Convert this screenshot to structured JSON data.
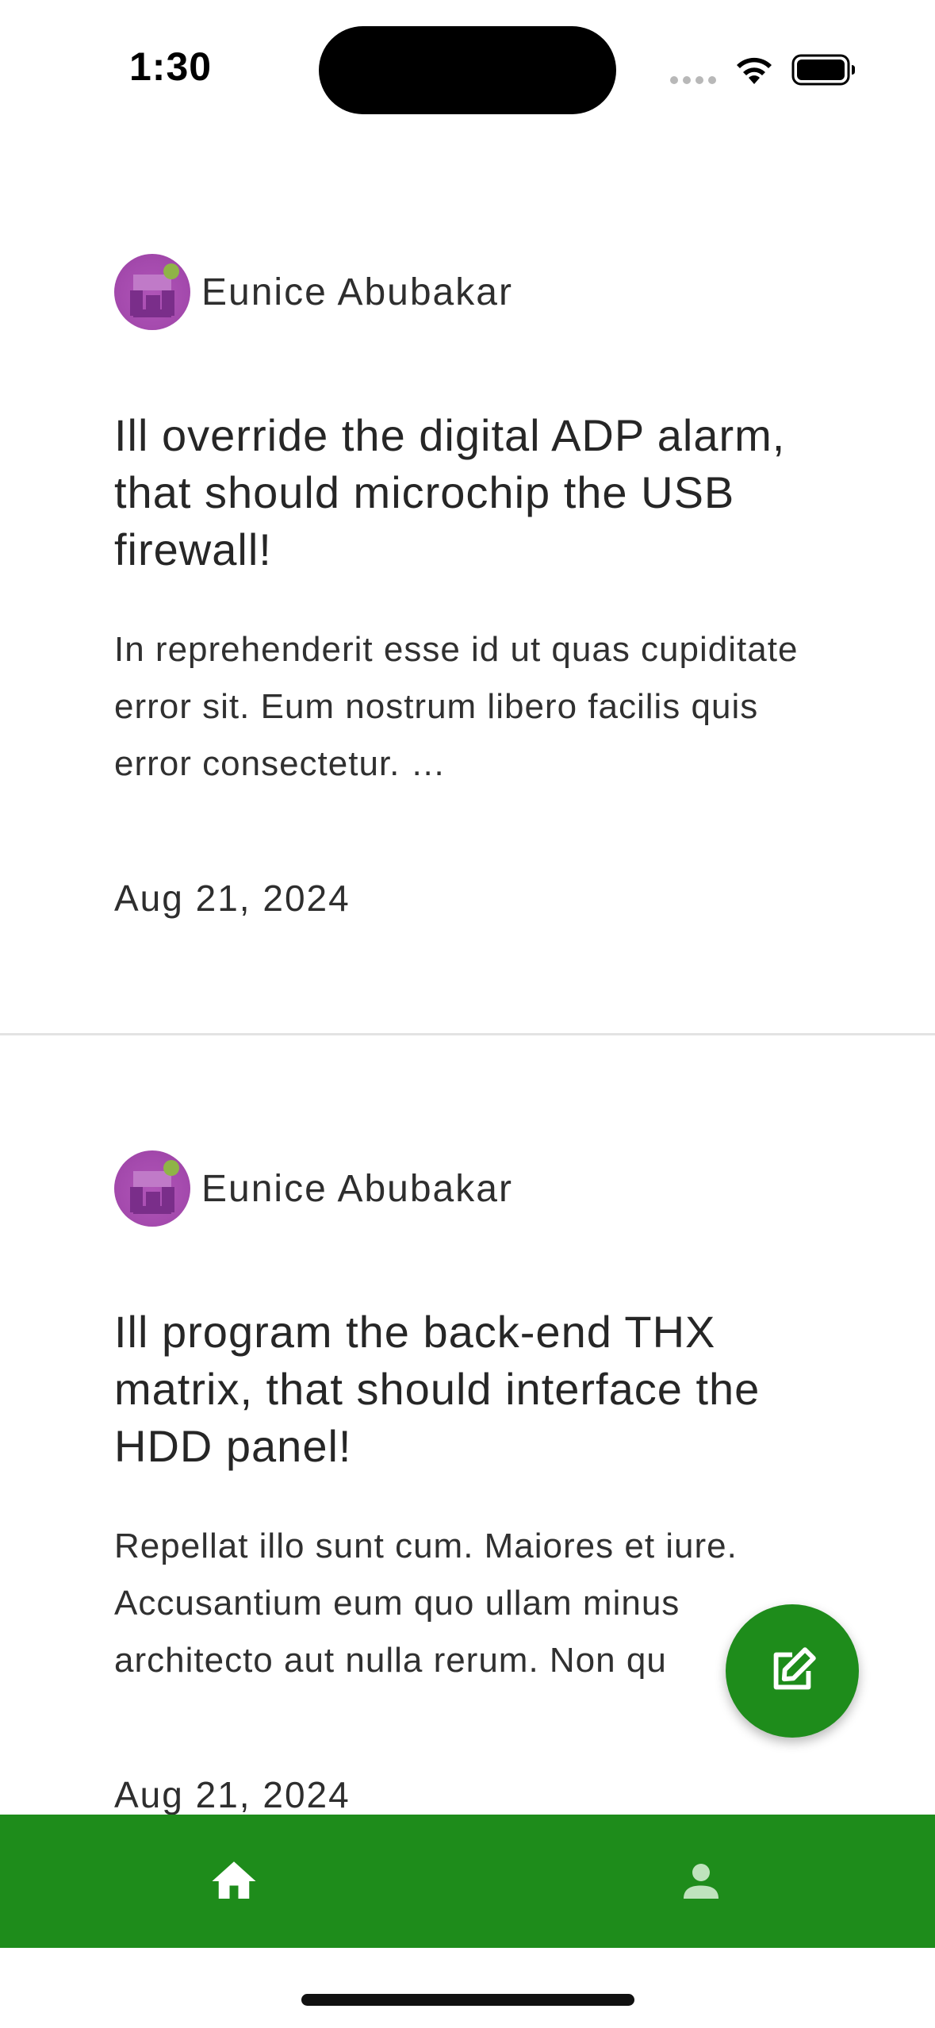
{
  "status_bar": {
    "time": "1:30",
    "icons": [
      "signal-dots-icon",
      "wifi-icon",
      "battery-icon"
    ]
  },
  "posts": [
    {
      "author": "Eunice Abubakar",
      "title": "Ill override the digital ADP alarm, that should microchip the USB firewall!",
      "excerpt": "In reprehenderit esse id ut quas cupiditate error sit. Eum nostrum libero facilis quis error consectetur. …",
      "date": "Aug 21, 2024"
    },
    {
      "author": "Eunice Abubakar",
      "title": "Ill program the back-end THX matrix, that should interface the HDD panel!",
      "excerpt": "Repellat illo sunt cum. Maiores et iure. Accusantium eum quo ullam minus architecto aut nulla rerum. Non qu",
      "date": "Aug 21, 2024"
    }
  ],
  "fab": {
    "icon": "edit-icon"
  },
  "bottom_nav": {
    "items": [
      {
        "icon": "home-icon",
        "active": true
      },
      {
        "icon": "profile-icon",
        "active": false
      }
    ]
  },
  "colors": {
    "accent": "#1e8c1b",
    "text": "#2b2b2b",
    "divider": "#e3e3e3",
    "avatar": "#a44aad"
  }
}
